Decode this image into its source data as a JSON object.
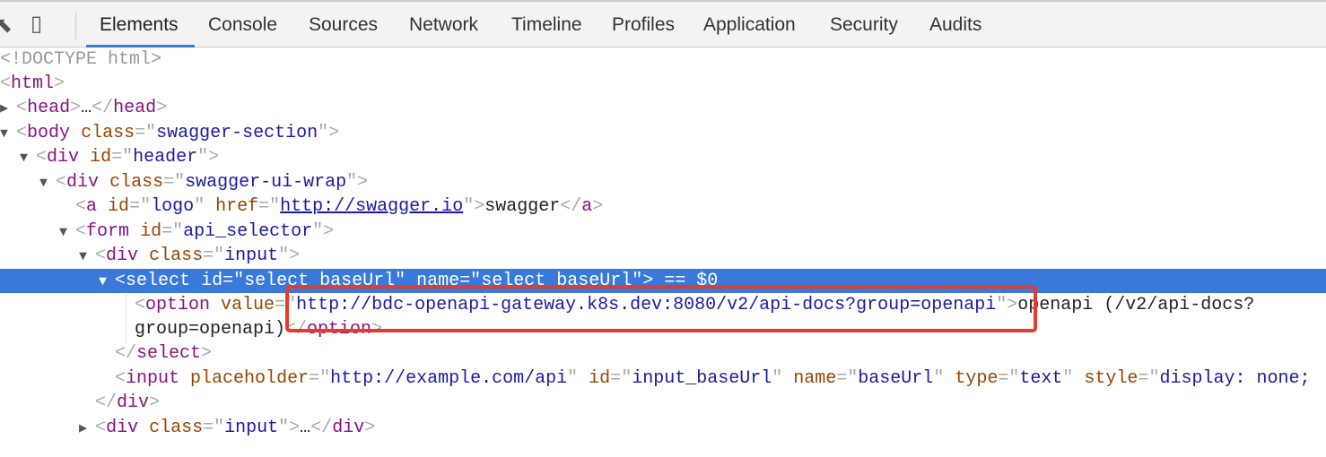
{
  "toolbar": {
    "tabs": [
      "Elements",
      "Console",
      "Sources",
      "Network",
      "Timeline",
      "Profiles",
      "Application",
      "Security",
      "Audits"
    ]
  },
  "dom": {
    "doctype": "<!DOCTYPE html>",
    "html": "html",
    "head": "head",
    "body": "body",
    "body_class": "swagger-section",
    "div": "div",
    "header_id": "header",
    "wrap_class": "swagger-ui-wrap",
    "a": "a",
    "logo_id": "logo",
    "href": "http://swagger.io",
    "logo_text": "swagger",
    "form": "form",
    "form_id": "api_selector",
    "input_class": "input",
    "select": "select",
    "select_id": "select_baseUrl",
    "select_name": "select_baseUrl",
    "dollar0": "== $0",
    "option": "option",
    "option_value": "http://bdc-openapi-gateway.k8s.dev:8080/v2/api-docs?group=openapi",
    "option_text1": "openapi (/v2/api-docs?",
    "option_text2": "group=openapi)",
    "input": "input",
    "input_placeholder": "http://example.com/api",
    "input_id": "input_baseUrl",
    "input_name": "baseUrl",
    "input_type": "text",
    "input_style": "display: none;",
    "ellipsis": "…"
  }
}
